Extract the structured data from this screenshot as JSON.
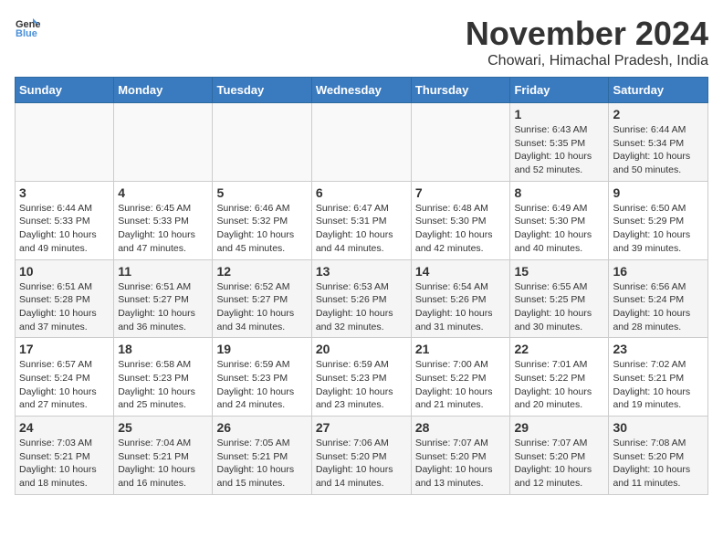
{
  "logo": {
    "general": "General",
    "blue": "Blue"
  },
  "title": "November 2024",
  "location": "Chowari, Himachal Pradesh, India",
  "weekdays": [
    "Sunday",
    "Monday",
    "Tuesday",
    "Wednesday",
    "Thursday",
    "Friday",
    "Saturday"
  ],
  "weeks": [
    [
      {
        "day": "",
        "info": ""
      },
      {
        "day": "",
        "info": ""
      },
      {
        "day": "",
        "info": ""
      },
      {
        "day": "",
        "info": ""
      },
      {
        "day": "",
        "info": ""
      },
      {
        "day": "1",
        "info": "Sunrise: 6:43 AM\nSunset: 5:35 PM\nDaylight: 10 hours and 52 minutes."
      },
      {
        "day": "2",
        "info": "Sunrise: 6:44 AM\nSunset: 5:34 PM\nDaylight: 10 hours and 50 minutes."
      }
    ],
    [
      {
        "day": "3",
        "info": "Sunrise: 6:44 AM\nSunset: 5:33 PM\nDaylight: 10 hours and 49 minutes."
      },
      {
        "day": "4",
        "info": "Sunrise: 6:45 AM\nSunset: 5:33 PM\nDaylight: 10 hours and 47 minutes."
      },
      {
        "day": "5",
        "info": "Sunrise: 6:46 AM\nSunset: 5:32 PM\nDaylight: 10 hours and 45 minutes."
      },
      {
        "day": "6",
        "info": "Sunrise: 6:47 AM\nSunset: 5:31 PM\nDaylight: 10 hours and 44 minutes."
      },
      {
        "day": "7",
        "info": "Sunrise: 6:48 AM\nSunset: 5:30 PM\nDaylight: 10 hours and 42 minutes."
      },
      {
        "day": "8",
        "info": "Sunrise: 6:49 AM\nSunset: 5:30 PM\nDaylight: 10 hours and 40 minutes."
      },
      {
        "day": "9",
        "info": "Sunrise: 6:50 AM\nSunset: 5:29 PM\nDaylight: 10 hours and 39 minutes."
      }
    ],
    [
      {
        "day": "10",
        "info": "Sunrise: 6:51 AM\nSunset: 5:28 PM\nDaylight: 10 hours and 37 minutes."
      },
      {
        "day": "11",
        "info": "Sunrise: 6:51 AM\nSunset: 5:27 PM\nDaylight: 10 hours and 36 minutes."
      },
      {
        "day": "12",
        "info": "Sunrise: 6:52 AM\nSunset: 5:27 PM\nDaylight: 10 hours and 34 minutes."
      },
      {
        "day": "13",
        "info": "Sunrise: 6:53 AM\nSunset: 5:26 PM\nDaylight: 10 hours and 32 minutes."
      },
      {
        "day": "14",
        "info": "Sunrise: 6:54 AM\nSunset: 5:26 PM\nDaylight: 10 hours and 31 minutes."
      },
      {
        "day": "15",
        "info": "Sunrise: 6:55 AM\nSunset: 5:25 PM\nDaylight: 10 hours and 30 minutes."
      },
      {
        "day": "16",
        "info": "Sunrise: 6:56 AM\nSunset: 5:24 PM\nDaylight: 10 hours and 28 minutes."
      }
    ],
    [
      {
        "day": "17",
        "info": "Sunrise: 6:57 AM\nSunset: 5:24 PM\nDaylight: 10 hours and 27 minutes."
      },
      {
        "day": "18",
        "info": "Sunrise: 6:58 AM\nSunset: 5:23 PM\nDaylight: 10 hours and 25 minutes."
      },
      {
        "day": "19",
        "info": "Sunrise: 6:59 AM\nSunset: 5:23 PM\nDaylight: 10 hours and 24 minutes."
      },
      {
        "day": "20",
        "info": "Sunrise: 6:59 AM\nSunset: 5:23 PM\nDaylight: 10 hours and 23 minutes."
      },
      {
        "day": "21",
        "info": "Sunrise: 7:00 AM\nSunset: 5:22 PM\nDaylight: 10 hours and 21 minutes."
      },
      {
        "day": "22",
        "info": "Sunrise: 7:01 AM\nSunset: 5:22 PM\nDaylight: 10 hours and 20 minutes."
      },
      {
        "day": "23",
        "info": "Sunrise: 7:02 AM\nSunset: 5:21 PM\nDaylight: 10 hours and 19 minutes."
      }
    ],
    [
      {
        "day": "24",
        "info": "Sunrise: 7:03 AM\nSunset: 5:21 PM\nDaylight: 10 hours and 18 minutes."
      },
      {
        "day": "25",
        "info": "Sunrise: 7:04 AM\nSunset: 5:21 PM\nDaylight: 10 hours and 16 minutes."
      },
      {
        "day": "26",
        "info": "Sunrise: 7:05 AM\nSunset: 5:21 PM\nDaylight: 10 hours and 15 minutes."
      },
      {
        "day": "27",
        "info": "Sunrise: 7:06 AM\nSunset: 5:20 PM\nDaylight: 10 hours and 14 minutes."
      },
      {
        "day": "28",
        "info": "Sunrise: 7:07 AM\nSunset: 5:20 PM\nDaylight: 10 hours and 13 minutes."
      },
      {
        "day": "29",
        "info": "Sunrise: 7:07 AM\nSunset: 5:20 PM\nDaylight: 10 hours and 12 minutes."
      },
      {
        "day": "30",
        "info": "Sunrise: 7:08 AM\nSunset: 5:20 PM\nDaylight: 10 hours and 11 minutes."
      }
    ]
  ]
}
